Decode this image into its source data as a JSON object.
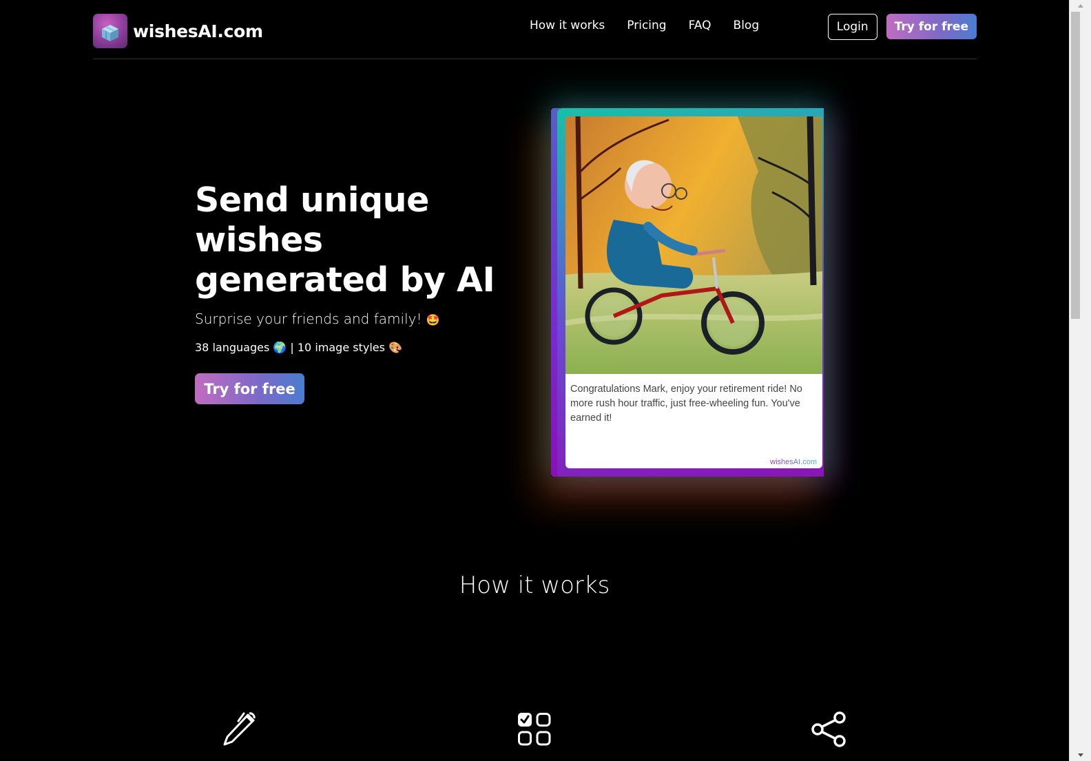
{
  "navbar": {
    "brand_name": "wishesAI.com",
    "brand_icon": "gift-box-icon",
    "links": [
      {
        "label": "How it works"
      },
      {
        "label": "Pricing"
      },
      {
        "label": "FAQ"
      },
      {
        "label": "Blog"
      }
    ],
    "login_label": "Login",
    "try_label": "Try for free"
  },
  "hero": {
    "title": "Send unique wishes generated by AI",
    "subtitle": "Surprise your friends and family!",
    "subtitle_emoji": "🤩",
    "languages_text": "38 languages",
    "languages_emoji": "🌍",
    "separator": "|",
    "styles_text": "10 image styles",
    "styles_emoji": "🎨",
    "cta_label": "Try for free"
  },
  "card": {
    "image_alt": "Cartoon of a smiling elderly man with glasses riding a red tricycle in an autumn park",
    "message": "Congratulations Mark, enjoy your retirement ride! No more rush hour traffic, just free-wheeling fun. You've earned it!",
    "watermark": "wishesAI.com"
  },
  "how_it_works": {
    "title": "How it works",
    "steps": [
      {
        "icon": "pencil-icon"
      },
      {
        "icon": "select-grid-icon"
      },
      {
        "icon": "share-icon"
      }
    ]
  },
  "colors": {
    "background": "#000000",
    "accent_gradient_start": "#c06cc0",
    "accent_gradient_end": "#4a7ccf",
    "card_border_top": "#18c0a8",
    "card_border_bottom": "#8a14b8"
  },
  "scrollbar": {
    "position_fraction": 0.0
  }
}
